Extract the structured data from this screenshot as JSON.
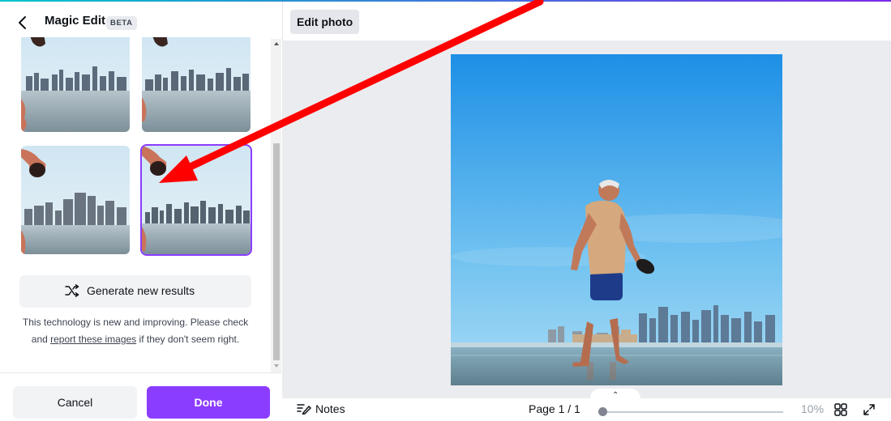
{
  "panel": {
    "title": "Magic Edit",
    "badge": "BETA",
    "generate_label": "Generate new results",
    "disclaimer_before": "This technology is new and improving. Please check and ",
    "disclaimer_link": "report these images",
    "disclaimer_after": " if they don't seem right.",
    "cancel_label": "Cancel",
    "done_label": "Done",
    "selected_result": 4
  },
  "toolbar": {
    "edit_photo_label": "Edit photo"
  },
  "bottom_bar": {
    "notes_label": "Notes",
    "page_indicator": "Page 1 / 1",
    "zoom_value": "10%"
  },
  "icons": {
    "back": "chevron-left-icon",
    "generate": "shuffle-icon",
    "notes": "notes-pen-icon",
    "collapse": "chevron-up-icon",
    "grid": "grid-view-icon",
    "fullscreen": "expand-icon"
  },
  "colors": {
    "accent": "#8b3dff",
    "annotation": "#ff0000",
    "canvas_bg": "#ebecf0"
  }
}
